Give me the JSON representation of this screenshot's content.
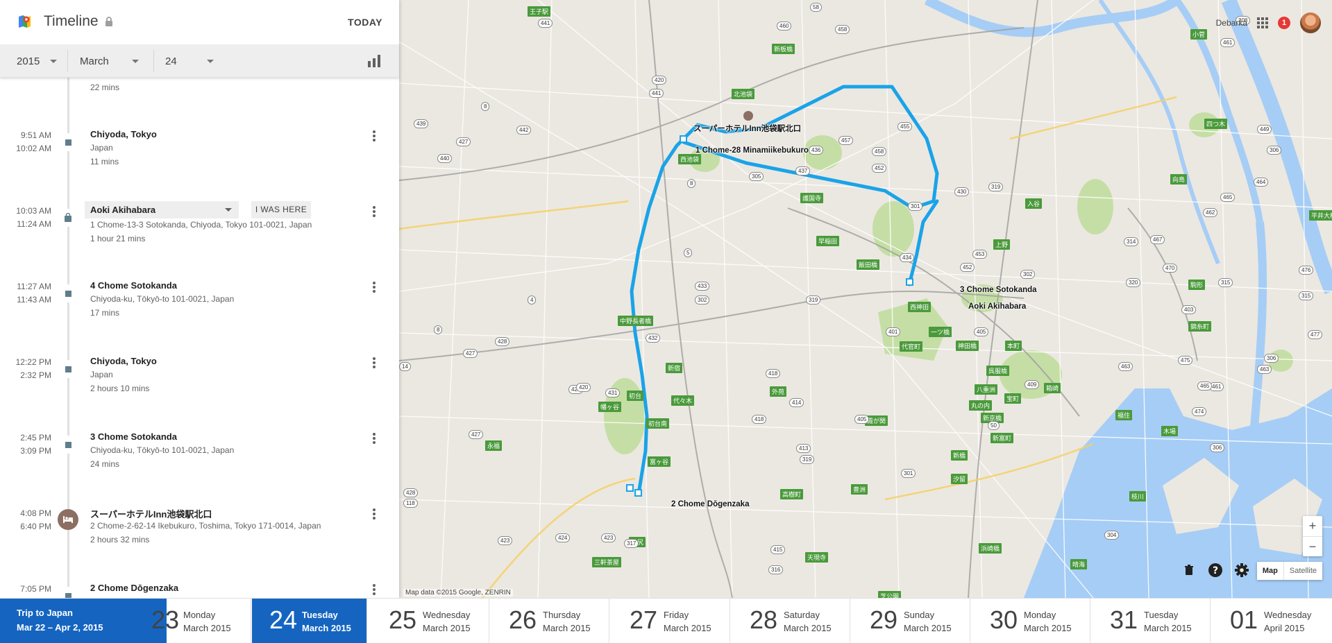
{
  "app": {
    "title": "Timeline",
    "today_label": "TODAY",
    "colors": {
      "accent": "#1565c0",
      "route": "#1aa3e8",
      "map_bg": "#ebe8e1",
      "park": "#c5dea5",
      "water": "#a6cdf5"
    },
    "icons": [
      "google-maps-logo-icon",
      "lock-icon",
      "bar-chart-icon",
      "more-vert-icon",
      "hotel-icon",
      "shopping-bag-icon",
      "apps-grid-icon",
      "trash-icon",
      "help-icon",
      "gear-icon"
    ]
  },
  "date_selector": {
    "year": "2015",
    "month": "March",
    "day": "24"
  },
  "timeline": [
    {
      "times": [
        "",
        ""
      ],
      "name": "",
      "address": "",
      "duration": "22 mins"
    },
    {
      "times": [
        "9:51 AM",
        "10:02 AM"
      ],
      "name": "Chiyoda, Tokyo",
      "address": "Japan",
      "duration": "11 mins",
      "icon": "stop"
    },
    {
      "times": [
        "10:03 AM",
        "11:24 AM"
      ],
      "name": "Aoki Akihabara",
      "address": "1 Chome-13-3 Sotokanda, Chiyoda, Tokyo 101-0021, Japan",
      "duration": "1 hour 21 mins",
      "icon": "shopping-bag",
      "was_here": "I WAS HERE"
    },
    {
      "times": [
        "11:27 AM",
        "11:43 AM"
      ],
      "name": "4 Chome Sotokanda",
      "address": "Chiyoda-ku, Tōkyō-to 101-0021, Japan",
      "duration": "17 mins",
      "icon": "stop"
    },
    {
      "times": [
        "12:22 PM",
        "2:32 PM"
      ],
      "name": "Chiyoda, Tokyo",
      "address": "Japan",
      "duration": "2 hours 10 mins",
      "icon": "stop"
    },
    {
      "times": [
        "2:45 PM",
        "3:09 PM"
      ],
      "name": "3 Chome Sotokanda",
      "address": "Chiyoda-ku, Tōkyō-to 101-0021, Japan",
      "duration": "24 mins",
      "icon": "stop"
    },
    {
      "times": [
        "4:08 PM",
        "6:40 PM"
      ],
      "name": "スーパーホテルInn池袋駅北口",
      "address": "2 Chome-2-62-14 Ikebukuro, Toshima, Tokyo 171-0014, Japan",
      "duration": "2 hours 32 mins",
      "icon": "hotel"
    },
    {
      "times": [
        "7:05 PM",
        ""
      ],
      "name": "2 Chome Dōgenzaka",
      "address": "",
      "duration": "",
      "icon": "stop"
    }
  ],
  "map": {
    "user": "Debarka",
    "notifications": "1",
    "zoom_in": "+",
    "zoom_out": "−",
    "map_type": {
      "map": "Map",
      "satellite": "Satellite"
    },
    "attribution": "Map data ©2015 Google, ZENRIN",
    "place_labels": [
      "スーパーホテルInn池袋駅北口",
      "1 Chome-28 Minamiikebukuro",
      "3 Chome Sotokanda",
      "Aoki Akihabara",
      "2 Chome Dōgenzaka"
    ],
    "station_labels": [
      "王子駅",
      "新板橋",
      "北池袋",
      "西池袋",
      "護国寺",
      "早稲田",
      "飯田橋",
      "中野長者橋",
      "新宿",
      "初台",
      "幡ヶ谷",
      "代々木",
      "初台南",
      "富ヶ谷",
      "外苑",
      "霞が関",
      "永福",
      "池尻",
      "三軒茶屋",
      "高樹町",
      "天現寺",
      "西神田",
      "一ツ橋",
      "代官町",
      "神田橋",
      "本町",
      "呉服橋",
      "八重洲",
      "丸の内",
      "新京橋",
      "新富町",
      "宝町",
      "箱崎",
      "福住",
      "木場",
      "枝川",
      "新橋",
      "汐留",
      "豊洲",
      "晴海",
      "上野",
      "入谷",
      "小菅",
      "四つ木",
      "向島",
      "平井大橋",
      "錦糸町",
      "駒形",
      "浜崎橋",
      "芝公園"
    ],
    "route_numbers": [
      "441",
      "58",
      "460",
      "458",
      "461",
      "308",
      "420",
      "441",
      "442",
      "439",
      "8",
      "440",
      "427",
      "457",
      "436",
      "455",
      "458",
      "452",
      "437",
      "305",
      "8",
      "449",
      "306",
      "464",
      "319",
      "301",
      "465",
      "462",
      "467",
      "430",
      "433",
      "302",
      "5",
      "4",
      "432",
      "427",
      "428",
      "8",
      "425",
      "418",
      "14",
      "420",
      "431",
      "414",
      "418",
      "405",
      "413",
      "319",
      "301",
      "463",
      "461",
      "306",
      "463",
      "465",
      "474",
      "475",
      "50",
      "409",
      "423",
      "304",
      "415",
      "316",
      "424",
      "317",
      "423",
      "428",
      "118",
      "427",
      "452",
      "453",
      "434",
      "302",
      "403",
      "405",
      "401",
      "319",
      "315",
      "320",
      "314",
      "470",
      "476",
      "315",
      "477",
      "306"
    ]
  },
  "trip": {
    "name": "Trip to Japan",
    "dates": "Mar 22 – Apr 2, 2015"
  },
  "days": [
    {
      "num": "23",
      "weekday": "Monday",
      "month": "March 2015",
      "state": "partial"
    },
    {
      "num": "24",
      "weekday": "Tuesday",
      "month": "March 2015",
      "state": "active"
    },
    {
      "num": "25",
      "weekday": "Wednesday",
      "month": "March 2015",
      "state": ""
    },
    {
      "num": "26",
      "weekday": "Thursday",
      "month": "March 2015",
      "state": ""
    },
    {
      "num": "27",
      "weekday": "Friday",
      "month": "March 2015",
      "state": ""
    },
    {
      "num": "28",
      "weekday": "Saturday",
      "month": "March 2015",
      "state": ""
    },
    {
      "num": "29",
      "weekday": "Sunday",
      "month": "March 2015",
      "state": ""
    },
    {
      "num": "30",
      "weekday": "Monday",
      "month": "March 2015",
      "state": ""
    },
    {
      "num": "31",
      "weekday": "Tuesday",
      "month": "March 2015",
      "state": ""
    },
    {
      "num": "01",
      "weekday": "Wednesday",
      "month": "April 2015",
      "state": ""
    }
  ]
}
